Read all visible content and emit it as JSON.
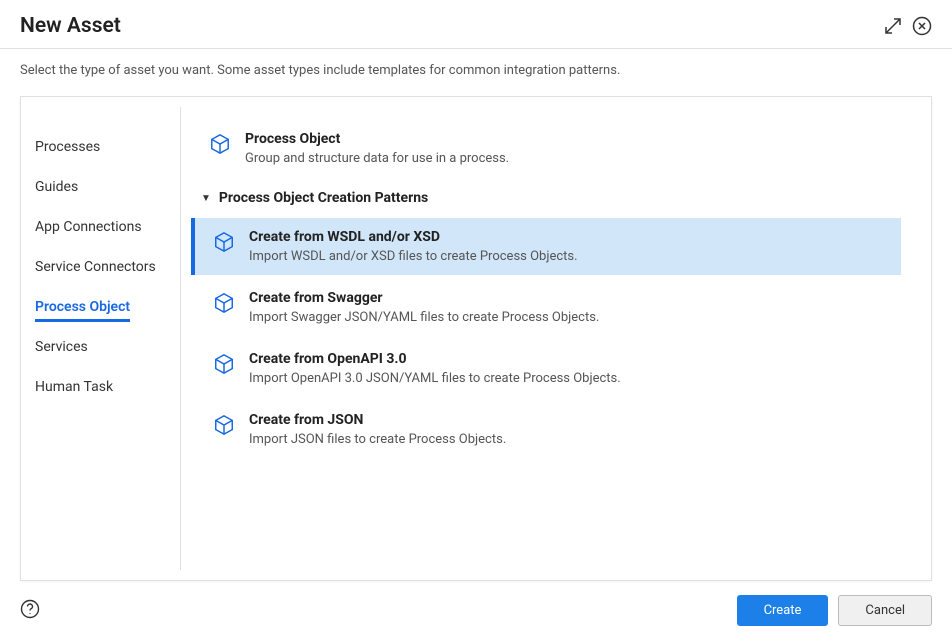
{
  "header": {
    "title": "New Asset"
  },
  "subtitle": "Select the type of asset you want. Some asset types include templates for common integration patterns.",
  "sidebar": {
    "items": [
      {
        "label": "Processes",
        "selected": false
      },
      {
        "label": "Guides",
        "selected": false
      },
      {
        "label": "App Connections",
        "selected": false
      },
      {
        "label": "Service Connectors",
        "selected": false
      },
      {
        "label": "Process Object",
        "selected": true
      },
      {
        "label": "Services",
        "selected": false
      },
      {
        "label": "Human Task",
        "selected": false
      }
    ]
  },
  "main": {
    "top_item": {
      "title": "Process Object",
      "desc": "Group and structure data for use in a process."
    },
    "section_title": "Process Object Creation Patterns",
    "options": [
      {
        "title": "Create from WSDL and/or XSD",
        "desc": "Import WSDL and/or XSD files to create Process Objects.",
        "selected": true
      },
      {
        "title": "Create from Swagger",
        "desc": "Import Swagger JSON/YAML files to create Process Objects.",
        "selected": false
      },
      {
        "title": "Create from OpenAPI 3.0",
        "desc": "Import OpenAPI 3.0 JSON/YAML files to create Process Objects.",
        "selected": false
      },
      {
        "title": "Create from JSON",
        "desc": "Import JSON files to create Process Objects.",
        "selected": false
      }
    ]
  },
  "footer": {
    "create_label": "Create",
    "cancel_label": "Cancel"
  }
}
